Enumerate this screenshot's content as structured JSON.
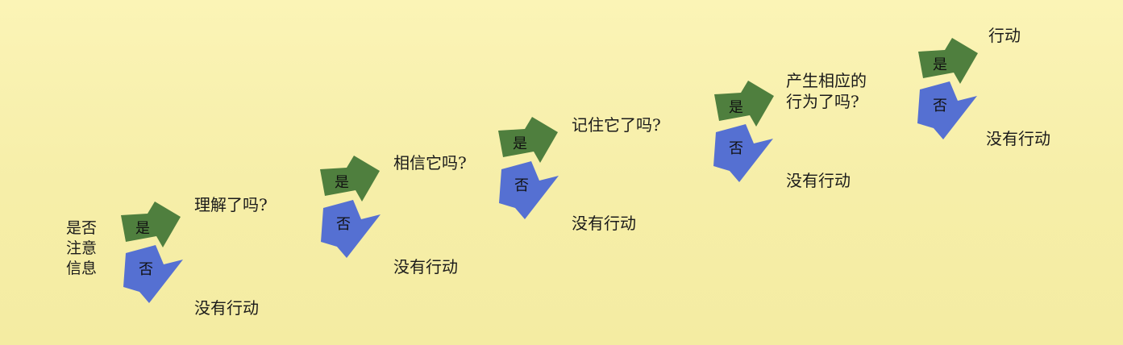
{
  "start_label": "是否\n注意\n信息",
  "stages": [
    {
      "question": "理解了吗?",
      "yes": "是",
      "no": "否",
      "no_result": "没有行动"
    },
    {
      "question": "相信它吗?",
      "yes": "是",
      "no": "否",
      "no_result": "没有行动"
    },
    {
      "question": "记住它了吗?",
      "yes": "是",
      "no": "否",
      "no_result": "没有行动"
    },
    {
      "question": "产生相应的\n行为了吗?",
      "yes": "是",
      "no": "否",
      "no_result": "没有行动"
    },
    {
      "question": "行动",
      "yes": "是",
      "no": "否",
      "no_result": "没有行动"
    }
  ],
  "colors": {
    "background": "#f7efaa",
    "yes_arrow": "#4f7f3e",
    "no_arrow": "#5570d2",
    "text": "#1a1a1a"
  }
}
